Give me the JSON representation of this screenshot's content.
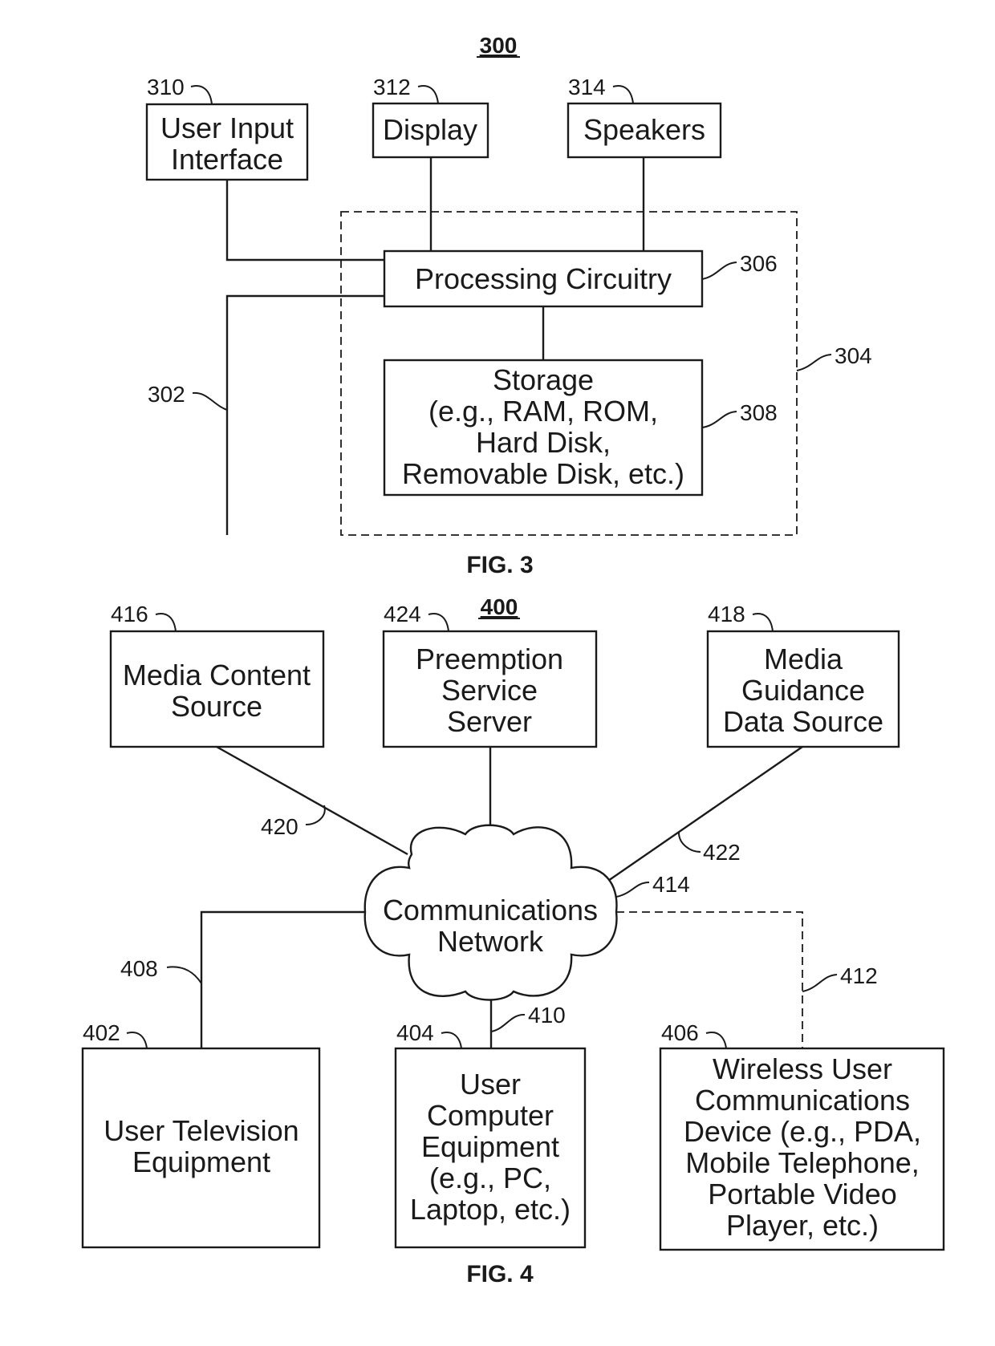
{
  "fig3": {
    "title": "300",
    "caption": "FIG. 3",
    "user_input_interface": {
      "ref": "310",
      "lines": [
        "User Input",
        "Interface"
      ]
    },
    "display": {
      "ref": "312",
      "lines": [
        "Display"
      ]
    },
    "speakers": {
      "ref": "314",
      "lines": [
        "Speakers"
      ]
    },
    "processing_circuitry": {
      "ref": "306",
      "lines": [
        "Processing Circuitry"
      ]
    },
    "storage": {
      "ref": "308",
      "lines": [
        "Storage",
        "(e.g., RAM, ROM,",
        "Hard Disk,",
        "Removable Disk, etc.)"
      ]
    },
    "control_circuitry_ref": "304",
    "io_path_ref": "302"
  },
  "fig4": {
    "title": "400",
    "caption": "FIG. 4",
    "media_content_source": {
      "ref": "416",
      "lines": [
        "Media Content",
        "Source"
      ]
    },
    "preemption_service_server": {
      "ref": "424",
      "lines": [
        "Preemption",
        "Service",
        "Server"
      ]
    },
    "media_guidance_data_source": {
      "ref": "418",
      "lines": [
        "Media",
        "Guidance",
        "Data Source"
      ]
    },
    "communications_network": {
      "ref": "414",
      "lines": [
        "Communications",
        "Network"
      ]
    },
    "user_television_equipment": {
      "ref": "402",
      "lines": [
        "User Television",
        "Equipment"
      ]
    },
    "user_computer_equipment": {
      "ref": "404",
      "lines": [
        "User",
        "Computer",
        "Equipment",
        "(e.g., PC,",
        "Laptop, etc.)"
      ]
    },
    "wireless_user_device": {
      "ref": "406",
      "lines": [
        "Wireless User",
        "Communications",
        "Device (e.g., PDA,",
        "Mobile Telephone,",
        "Portable Video",
        "Player, etc.)"
      ]
    },
    "link_refs": {
      "media_content_link": "420",
      "media_guidance_link": "422",
      "television_link": "408",
      "computer_link": "410",
      "wireless_link": "412"
    }
  }
}
